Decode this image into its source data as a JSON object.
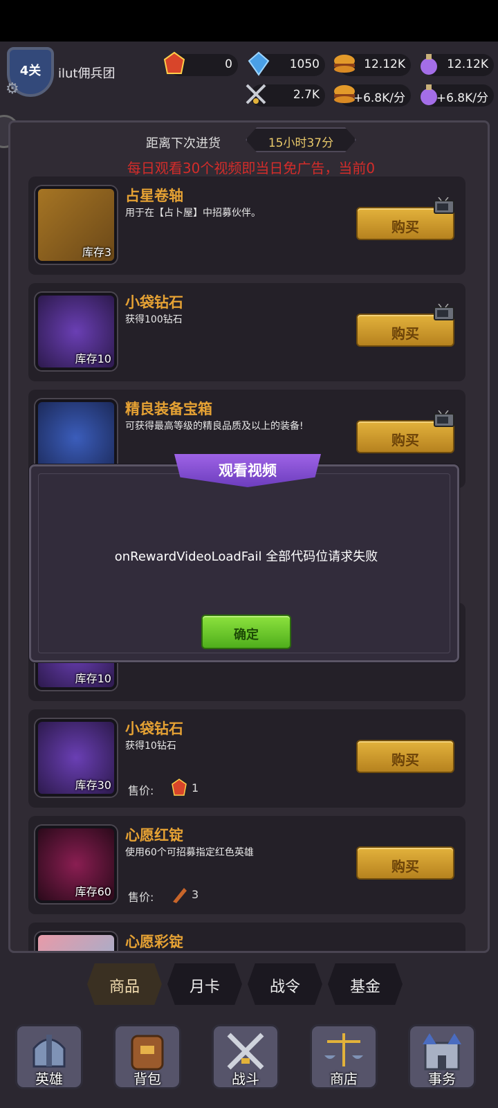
{
  "header": {
    "level": "4关",
    "team_name": "ilut佣兵团",
    "resources": [
      {
        "name": "ruby",
        "value": "0"
      },
      {
        "name": "diamond",
        "value": "1050"
      },
      {
        "name": "burger",
        "value": "12.12K"
      },
      {
        "name": "potion",
        "value": "12.12K"
      },
      {
        "name": "swords",
        "value": "2.7K"
      },
      {
        "name": "burger-rate",
        "value": "+6.8K/分"
      },
      {
        "name": "potion-rate",
        "value": "+6.8K/分"
      }
    ]
  },
  "shop": {
    "next_restock_label": "距离下次进货",
    "timer": "15小时37分",
    "ad_note": "每日观看30个视频即当日免广告，当前0",
    "buy_label": "购买",
    "price_label": "售价:",
    "items": [
      {
        "name": "占星卷轴",
        "desc": "用于在【占卜屋】中招募伙伴。",
        "stock": "库存3"
      },
      {
        "name": "小袋钻石",
        "desc": "获得100钻石",
        "stock": "库存10"
      },
      {
        "name": "精良装备宝箱",
        "desc": "可获得最高等级的精良品质及以上的装备!",
        "stock": ""
      },
      {
        "name": "",
        "desc": "",
        "stock": "库存10"
      },
      {
        "name": "小袋钻石",
        "desc": "获得10钻石",
        "stock": "库存30",
        "price": "1"
      },
      {
        "name": "心愿红锭",
        "desc": "使用60个可招募指定红色英雄",
        "stock": "库存60",
        "price": "3"
      },
      {
        "name": "心愿彩锭",
        "desc": "",
        "stock": ""
      }
    ]
  },
  "modal": {
    "title": "观看视频",
    "message": "onRewardVideoLoadFail 全部代码位请求失败",
    "ok_label": "确定"
  },
  "sub_tabs": [
    "商品",
    "月卡",
    "战令",
    "基金"
  ],
  "bottom_nav": [
    "英雄",
    "背包",
    "战斗",
    "商店",
    "事务"
  ],
  "colors": {
    "accent_gold": "#e6a234",
    "alert_red": "#d42c2a",
    "ok_green": "#6cc82c",
    "ribbon_purple": "#8a54d8"
  }
}
